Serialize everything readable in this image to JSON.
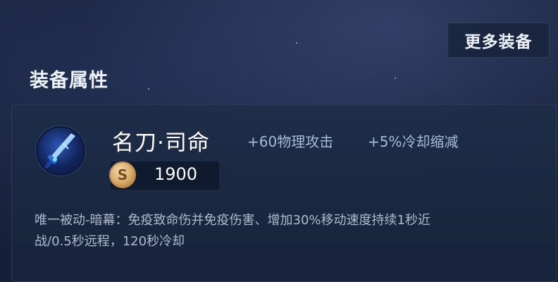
{
  "header": {
    "more_equipment_label": "更多装备",
    "section_title": "装备属性"
  },
  "item": {
    "icon": "blade-icon",
    "name": "名刀·司命",
    "stats": [
      "+60物理攻击",
      "+5%冷却缩减"
    ],
    "price": "1900",
    "currency_icon": "gold-coin-icon",
    "currency_symbol": "S",
    "description_line1": "唯一被动-暗幕：免疫致命伤并免疫伤害、增加30%移动速度持续1秒近",
    "description_line2": "战/0.5秒远程，120秒冷却"
  },
  "colors": {
    "background": "#17223b",
    "card": "#1e2d48",
    "title_text": "#eef2fb",
    "stat_text": "#a8bbda",
    "desc_text": "#aebad0"
  }
}
